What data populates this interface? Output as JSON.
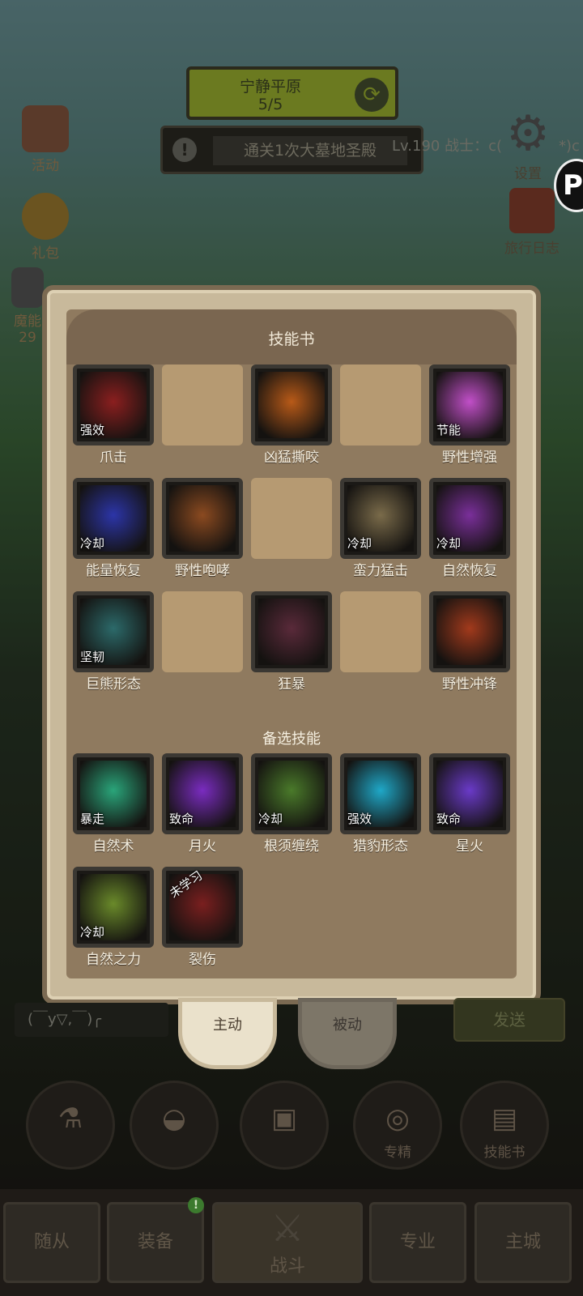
{
  "header": {
    "zone_name": "宁静平原",
    "zone_progress": "5/5",
    "quest_text": "通关1次大墓地圣殿",
    "level_text": "Lv.190 战士：c(",
    "level_tail": "*)c"
  },
  "left_icons": [
    {
      "label": "活动"
    },
    {
      "label": "礼包"
    },
    {
      "label": "魔能"
    },
    {
      "label": "29"
    }
  ],
  "right_icons": [
    {
      "label": "设置"
    },
    {
      "label": "旅行日志"
    }
  ],
  "panel": {
    "title": "技能书",
    "grid": [
      {
        "name": "爪击",
        "tag": "强效",
        "icon": "claw-strike-icon",
        "color": "#8b1f1f",
        "empty": false
      },
      {
        "name": "",
        "tag": "",
        "icon": "",
        "empty": true
      },
      {
        "name": "凶猛撕咬",
        "tag": "",
        "icon": "ferocious-bite-icon",
        "color": "#b85a18",
        "empty": false
      },
      {
        "name": "",
        "tag": "",
        "icon": "",
        "empty": true
      },
      {
        "name": "野性增强",
        "tag": "节能",
        "icon": "paw-icon",
        "color": "#c14fc8",
        "empty": false
      },
      {
        "name": "能量恢复",
        "tag": "冷却",
        "icon": "lightning-icon",
        "color": "#2c35a8",
        "empty": false
      },
      {
        "name": "野性咆哮",
        "tag": "",
        "icon": "roar-icon",
        "color": "#8b4a20",
        "empty": false
      },
      {
        "name": "",
        "tag": "",
        "icon": "",
        "empty": true
      },
      {
        "name": "蛮力猛击",
        "tag": "冷却",
        "icon": "rhino-icon",
        "color": "#7a6b4a",
        "empty": false
      },
      {
        "name": "自然恢复",
        "tag": "冷却",
        "icon": "leaf-icon",
        "color": "#7a2f9a",
        "empty": false
      },
      {
        "name": "巨熊形态",
        "tag": "坚韧",
        "icon": "bear-form-icon",
        "color": "#2c6a6a",
        "empty": false
      },
      {
        "name": "",
        "tag": "",
        "icon": "",
        "empty": true
      },
      {
        "name": "狂暴",
        "tag": "",
        "icon": "berserk-bear-icon",
        "color": "#5a2a3a",
        "empty": false
      },
      {
        "name": "",
        "tag": "",
        "icon": "",
        "empty": true
      },
      {
        "name": "野性冲锋",
        "tag": "",
        "icon": "charge-icon",
        "color": "#a23a1c",
        "empty": false
      }
    ],
    "alt_title": "备选技能",
    "alt": [
      {
        "name": "自然术",
        "tag": "暴走",
        "icon": "nature-icon",
        "color": "#2aa57a"
      },
      {
        "name": "月火",
        "tag": "致命",
        "icon": "moonfire-icon",
        "color": "#7a2cc0"
      },
      {
        "name": "根须缠绕",
        "tag": "冷却",
        "icon": "roots-icon",
        "color": "#4a7a2a"
      },
      {
        "name": "猎豹形态",
        "tag": "强效",
        "icon": "cheetah-icon",
        "color": "#1fa8c8"
      },
      {
        "name": "星火",
        "tag": "致命",
        "icon": "starfire-icon",
        "color": "#6a3ac8"
      },
      {
        "name": "自然之力",
        "tag": "冷却",
        "icon": "treant-icon",
        "color": "#6a8a2a"
      },
      {
        "name": "裂伤",
        "tag": "未学习",
        "icon": "lacerate-icon",
        "color": "#7a1f1f"
      }
    ]
  },
  "tabs": {
    "active": "主动",
    "inactive": "被动"
  },
  "chat": {
    "placeholder": "(￣y▽,￣)╭",
    "send": "发送"
  },
  "actions": [
    {
      "label": "",
      "icon": "potion-icon"
    },
    {
      "label": "",
      "icon": "bread-icon"
    },
    {
      "label": "",
      "icon": "chest-icon"
    },
    {
      "label": "专精",
      "icon": "specialization-icon"
    },
    {
      "label": "技能书",
      "icon": "skillbook-icon"
    }
  ],
  "nav": [
    {
      "label": "随从"
    },
    {
      "label": "装备"
    },
    {
      "label": "战斗"
    },
    {
      "label": "专业"
    },
    {
      "label": "主城"
    }
  ],
  "badge": "!"
}
